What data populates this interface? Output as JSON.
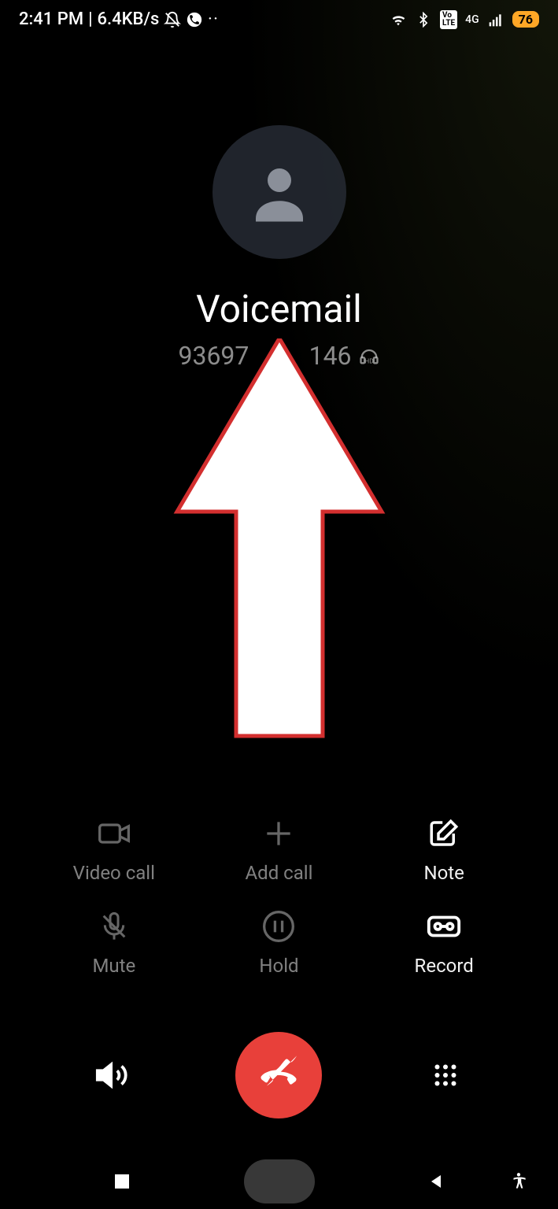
{
  "status": {
    "time": "2:41 PM",
    "data_rate": "6.4KB/s",
    "network_type": "4G",
    "volte": "VoLTE",
    "battery_pct": "76"
  },
  "contact": {
    "name": "Voicemail",
    "number_prefix": "93697",
    "number_suffix": "146"
  },
  "controls": {
    "video_call": "Video call",
    "add_call": "Add call",
    "note": "Note",
    "mute": "Mute",
    "hold": "Hold",
    "record": "Record"
  }
}
